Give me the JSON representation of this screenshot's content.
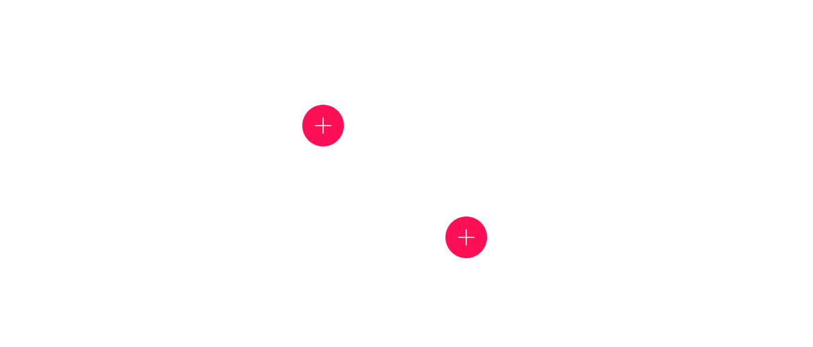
{
  "colors": {
    "background": "#ffffff",
    "hotspot_fill": "#ff0f55",
    "icon_stroke": "#ffffff"
  },
  "hotspots": [
    {
      "icon": "plus-icon"
    },
    {
      "icon": "plus-icon"
    }
  ]
}
